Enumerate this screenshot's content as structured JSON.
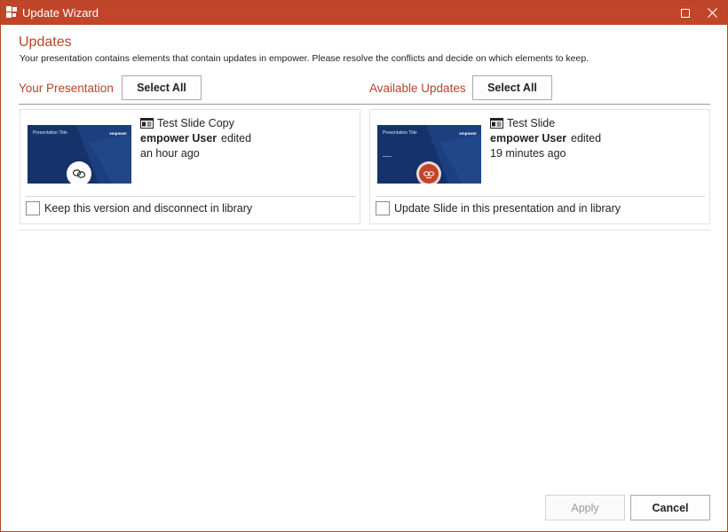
{
  "window": {
    "title": "Update Wizard"
  },
  "header": {
    "heading": "Updates",
    "description": "Your presentation contains elements that contain updates in empower. Please resolve the conflicts and decide on which elements to keep."
  },
  "left_section": {
    "label": "Your Presentation",
    "select_all": "Select All",
    "card": {
      "slide_name": "Test Slide Copy",
      "user": "empower User",
      "action": "edited",
      "time": "an hour ago",
      "thumbnail_title": "Presentation Title",
      "thumbnail_logo": "empower",
      "checkbox_label": "Keep this version and disconnect in library",
      "checked": false,
      "badge_icon": "link-icon"
    }
  },
  "right_section": {
    "label": "Available Updates",
    "select_all": "Select All",
    "card": {
      "slide_name": "Test Slide",
      "user": "empower User",
      "action": "edited",
      "time": "19 minutes ago",
      "thumbnail_title": "Presentation Title",
      "thumbnail_logo": "empower",
      "checkbox_label": "Update Slide in this presentation and in library",
      "checked": false,
      "badge_icon": "update-icon"
    }
  },
  "footer": {
    "apply": "Apply",
    "cancel": "Cancel"
  },
  "colors": {
    "accent": "#c0452b",
    "thumbnail_bg": "#15326b"
  }
}
